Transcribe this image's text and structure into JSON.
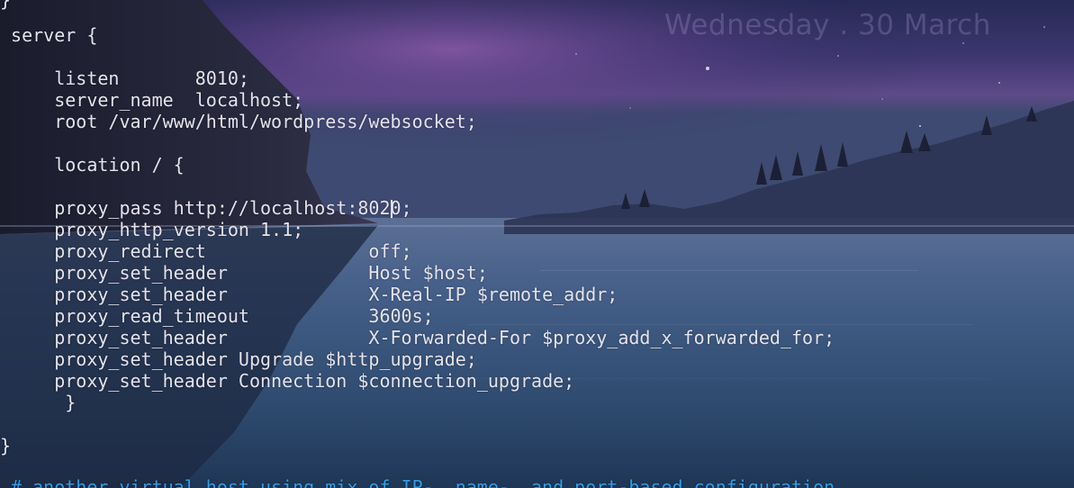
{
  "desktop": {
    "clock_text": "Wednesday . 30 March",
    "wallpaper": "night-lake-mountains",
    "colors": {
      "sky_top": "#2b2e58",
      "sky_purple": "#6a4a8a",
      "water": "#3a5578",
      "text": "#e4e2ec",
      "comment": "#2f9ee6"
    }
  },
  "editor": {
    "lines": [
      {
        "indent": "",
        "text": "}"
      },
      {
        "indent": " ",
        "text": "server {"
      },
      {
        "indent": "     ",
        "text": "listen       8010;"
      },
      {
        "indent": "     ",
        "text": "server_name  localhost;"
      },
      {
        "indent": "     ",
        "text": "root /var/www/html/wordpress/websocket;"
      },
      {
        "indent": "     ",
        "text": "location / {"
      },
      {
        "indent": "     ",
        "text_before_cursor": "proxy_pass http://localhost:802",
        "text_after_cursor": "0;"
      },
      {
        "indent": "     ",
        "text": "proxy_http_version 1.1;"
      },
      {
        "indent": "     ",
        "text": "proxy_redirect               off;"
      },
      {
        "indent": "     ",
        "text": "proxy_set_header             Host $host;"
      },
      {
        "indent": "     ",
        "text": "proxy_set_header             X-Real-IP $remote_addr;"
      },
      {
        "indent": "     ",
        "text": "proxy_read_timeout           3600s;"
      },
      {
        "indent": "     ",
        "text": "proxy_set_header             X-Forwarded-For $proxy_add_x_forwarded_for;"
      },
      {
        "indent": "     ",
        "text": "proxy_set_header Upgrade $http_upgrade;"
      },
      {
        "indent": "     ",
        "text": "proxy_set_header Connection $connection_upgrade;"
      },
      {
        "indent": "      ",
        "text": "}"
      },
      {
        "indent": "",
        "text": "}"
      },
      {
        "indent": " ",
        "text": "# another virtual host using mix of IP-, name-, and port-based configuration"
      }
    ]
  }
}
